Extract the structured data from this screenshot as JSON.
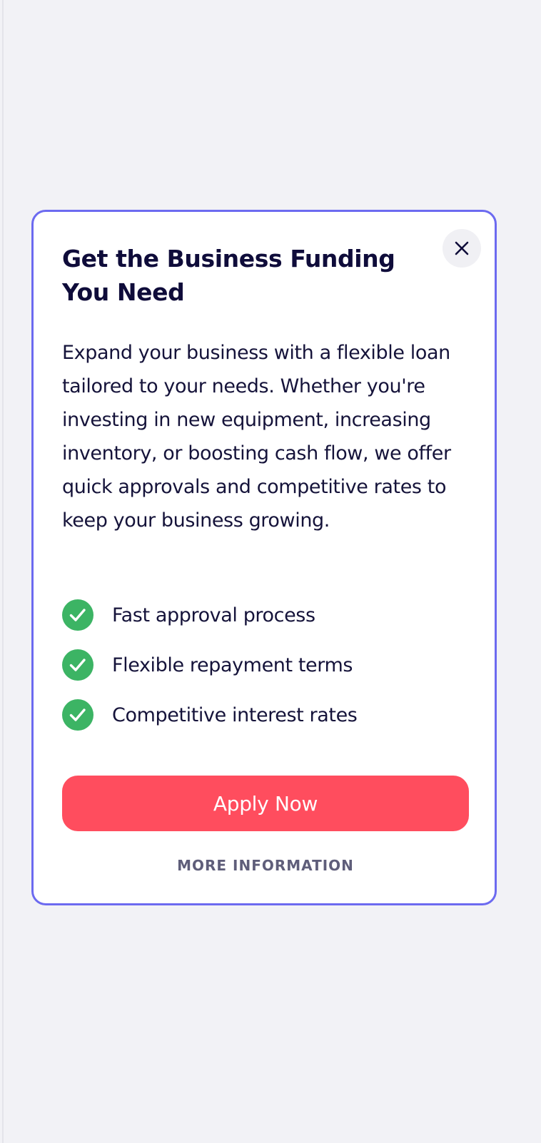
{
  "modal": {
    "title": "Get the Business Funding You Need",
    "description": "Expand your business with a flexible loan tailored to your needs. Whether you're investing in new equipment, increasing inventory, or boosting cash flow, we offer quick approvals and competitive rates to keep your business growing.",
    "close_icon": "close-icon",
    "features": [
      {
        "label": "Fast approval process",
        "icon": "check-circle-icon"
      },
      {
        "label": "Flexible repayment terms",
        "icon": "check-circle-icon"
      },
      {
        "label": "Competitive interest rates",
        "icon": "check-circle-icon"
      }
    ],
    "apply_label": "Apply Now",
    "more_info_label": "MORE INFORMATION"
  },
  "colors": {
    "page_background": "#f2f2f6",
    "modal_border": "#6c6af0",
    "title_text": "#0f0c3a",
    "check_green": "#3cb464",
    "apply_button": "#ff4d5e",
    "more_info_text": "#5f5e7a"
  }
}
